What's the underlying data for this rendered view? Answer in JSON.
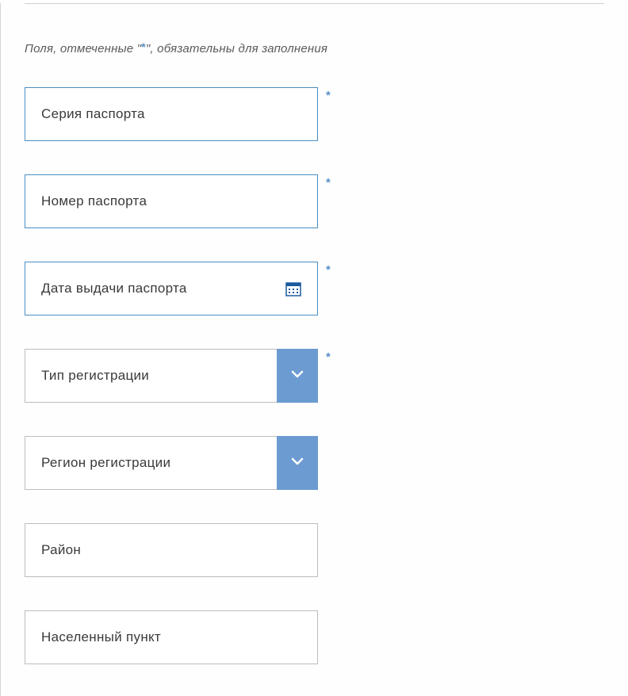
{
  "requiredNote": {
    "prefix": "Поля, отмеченные \"",
    "asterisk": "*",
    "suffix": "\", обязательны для заполнения"
  },
  "fields": {
    "passportSeries": {
      "label": "Серия паспорта",
      "required": true
    },
    "passportNumber": {
      "label": "Номер паспорта",
      "required": true
    },
    "passportIssueDate": {
      "label": "Дата выдачи паспорта",
      "required": true
    },
    "registrationType": {
      "label": "Тип регистрации",
      "required": true
    },
    "registrationRegion": {
      "label": "Регион регистрации",
      "required": false
    },
    "district": {
      "label": "Район",
      "required": false
    },
    "locality": {
      "label": "Населенный пункт",
      "required": false
    }
  },
  "colors": {
    "fieldBorderActive": "#4a8ec2",
    "fieldBorderNormal": "#bdbdbd",
    "dropdownButton": "#6b9bd1",
    "asterisk": "#5a8fc6",
    "text": "#3a3a3a",
    "noteText": "#5a5a5a"
  }
}
